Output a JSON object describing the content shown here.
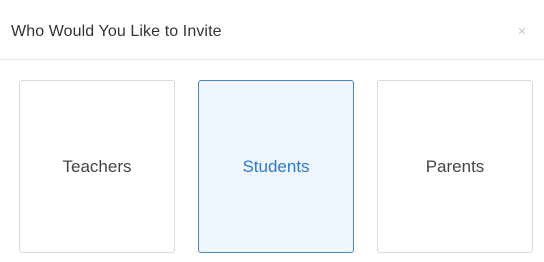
{
  "modal": {
    "title": "Who Would You Like to Invite",
    "close_glyph": "×"
  },
  "options": [
    {
      "label": "Teachers",
      "selected": false
    },
    {
      "label": "Students",
      "selected": true
    },
    {
      "label": "Parents",
      "selected": false
    }
  ],
  "colors": {
    "selected_border": "#4a8ac4",
    "selected_background": "#eef5fd",
    "selected_text": "#2f7bc4",
    "default_border": "#dcdcdc",
    "default_text": "#444444"
  }
}
